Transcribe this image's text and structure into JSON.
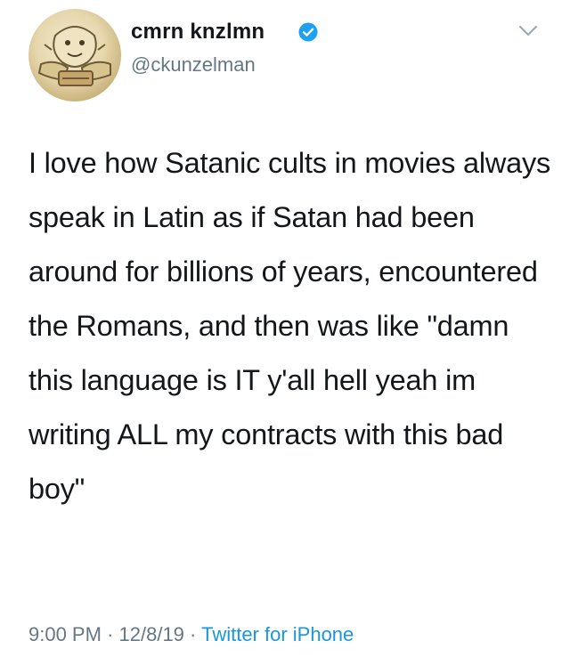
{
  "tweet": {
    "display_name": "cmrn knzlmn",
    "handle": "@ckunzelman",
    "verified": true,
    "text": "I love how Satanic cults in movies always speak in Latin as if Satan had been around for billions of years, encountered the Romans, and then was like \"damn this language is IT y'all hell yeah im writing ALL my contracts with this bad boy\"",
    "time": "9:00 PM",
    "separator": "·",
    "date": "12/8/19",
    "source": "Twitter for iPhone"
  },
  "icons": {
    "verified": "verified-badge-icon",
    "caret": "chevron-down-icon"
  },
  "colors": {
    "text": "#14171a",
    "secondary": "#657786",
    "link": "#1b95e0",
    "verified": "#1da1f2"
  }
}
